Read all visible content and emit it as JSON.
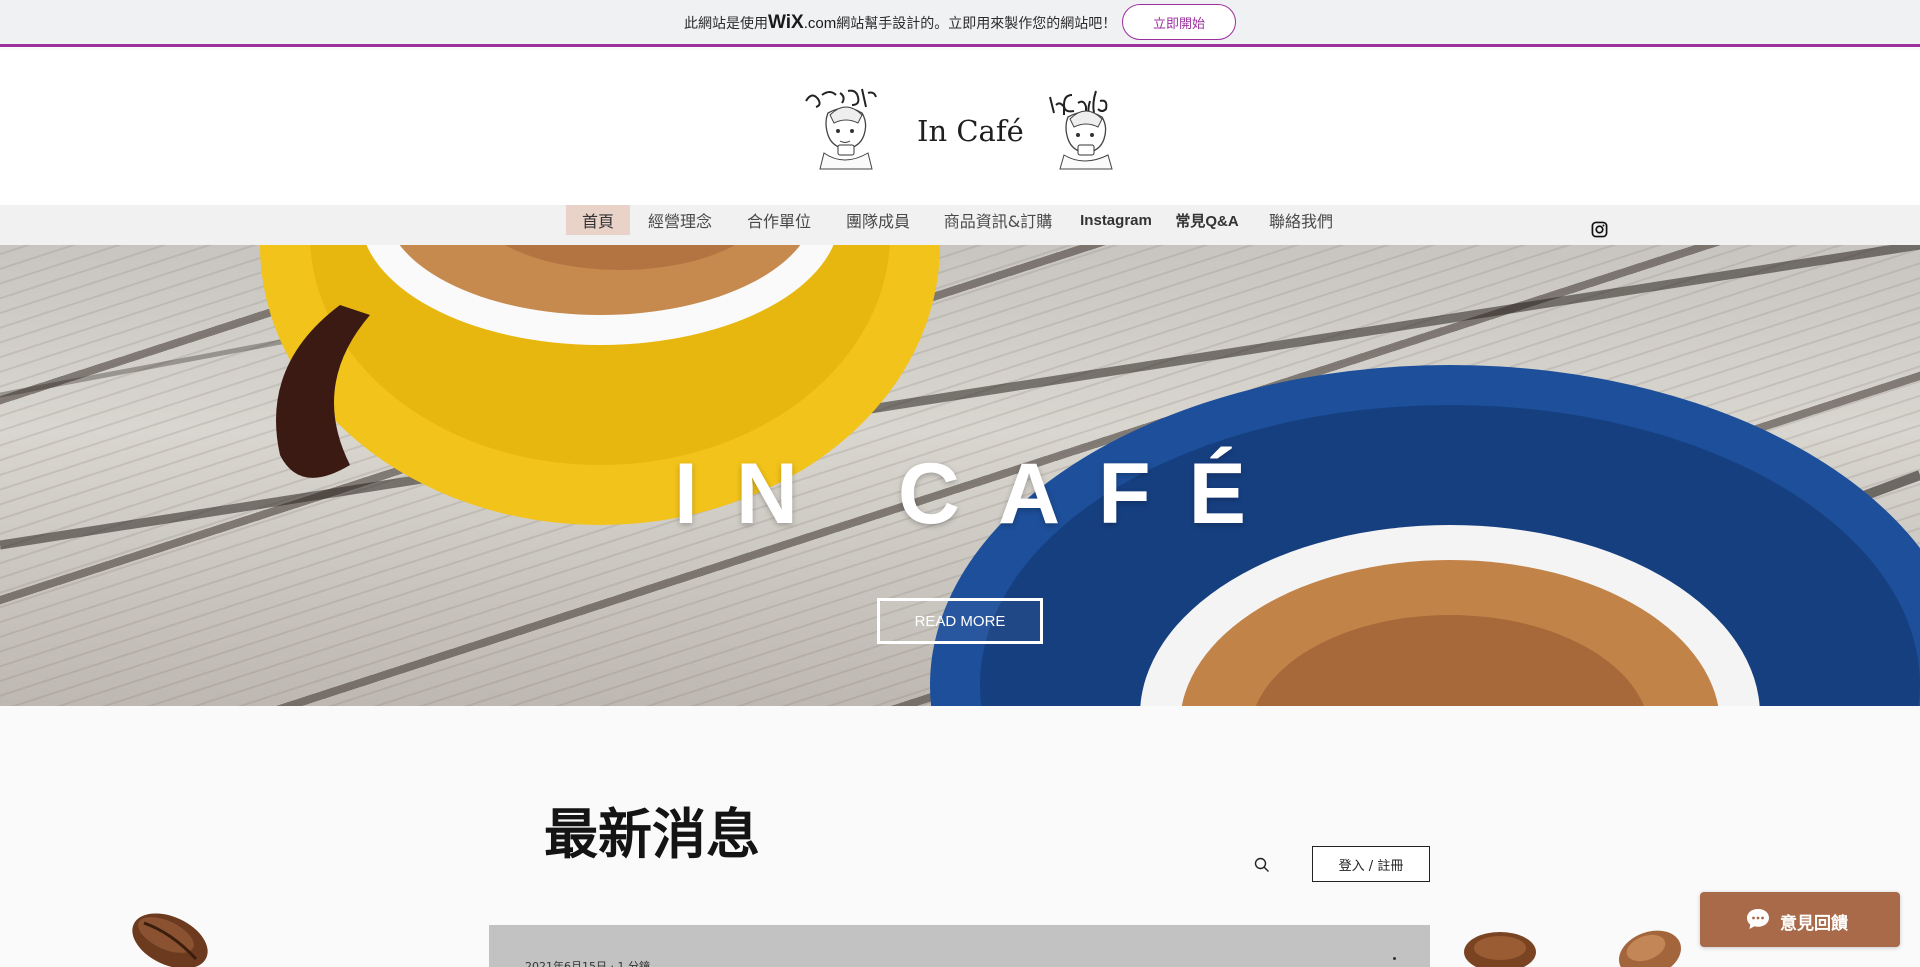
{
  "wix_banner": {
    "text_before": "此網站是使用",
    "wix_logo": "WiX",
    "dotcom": ".com",
    "text_after": "網站幫手設計的。立即用來製作您的網站吧！",
    "cta_label": "立即開始"
  },
  "header": {
    "site_title": "In Café"
  },
  "nav": {
    "items": [
      {
        "label": "首頁",
        "active": true
      },
      {
        "label": "經營理念"
      },
      {
        "label": "合作單位"
      },
      {
        "label": "團隊成員"
      },
      {
        "label": "商品資訊&訂購"
      },
      {
        "label": "Instagram"
      },
      {
        "label": "常見Q&A"
      },
      {
        "label": "聯絡我們"
      }
    ],
    "social_icon": "instagram-icon"
  },
  "hero": {
    "title": "IN CAFÉ",
    "button_label": "READ MORE"
  },
  "news": {
    "title": "最新消息",
    "login_label": "登入 / 註冊",
    "post": {
      "meta": "2021年6月15日 · 1 分鐘"
    }
  },
  "feedback": {
    "label": "意見回饋"
  },
  "colors": {
    "wix_accent": "#9b2f9e",
    "nav_active_bg": "#e9d3c8",
    "feedback_bg": "#a86a49",
    "saucer_yellow": "#f2c31a",
    "saucer_blue": "#1d4f9a"
  }
}
